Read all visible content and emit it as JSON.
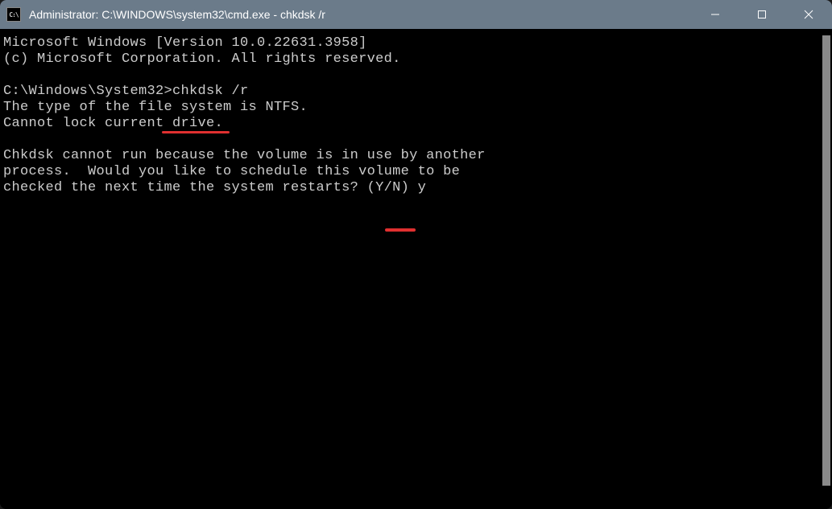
{
  "titlebar": {
    "icon_text": "C:\\",
    "title": "Administrator: C:\\WINDOWS\\system32\\cmd.exe - chkdsk  /r"
  },
  "terminal": {
    "line1": "Microsoft Windows [Version 10.0.22631.3958]",
    "line2": "(c) Microsoft Corporation. All rights reserved.",
    "blank1": "",
    "prompt_prefix": "C:\\Windows\\System32>",
    "command": "chkdsk /r",
    "line4": "The type of the file system is NTFS.",
    "line5": "Cannot lock current drive.",
    "blank2": "",
    "line6": "Chkdsk cannot run because the volume is in use by another",
    "line7": "process.  Would you like to schedule this volume to be",
    "line8_prefix": "checked the next time the system restarts? (Y/N) ",
    "user_input": "y"
  }
}
